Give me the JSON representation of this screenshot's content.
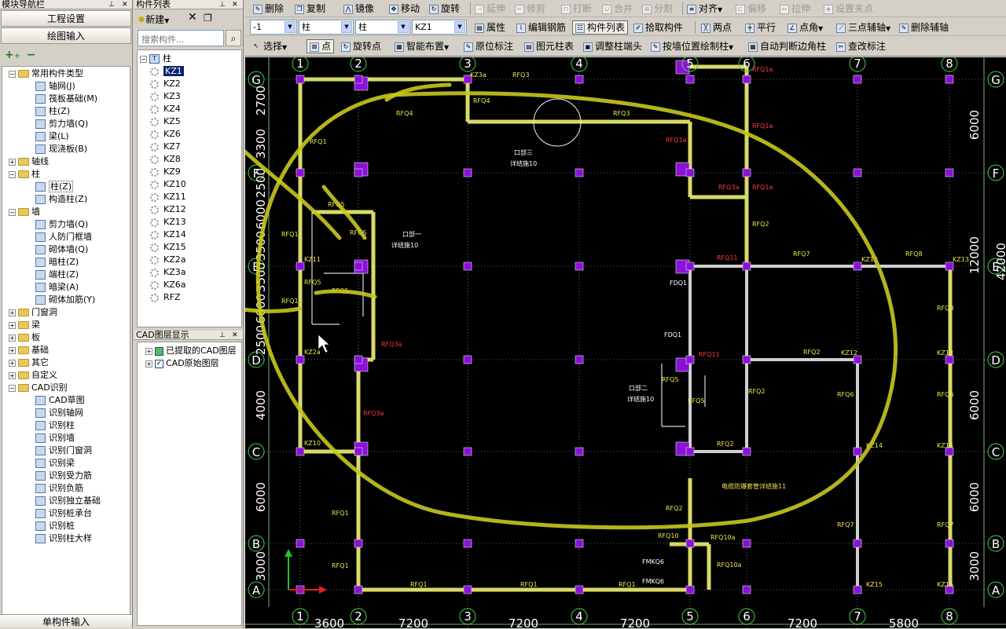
{
  "nav": {
    "title": "模块导航栏",
    "btn_project_settings": "工程设置",
    "btn_drawing_input": "绘图输入",
    "tree": [
      {
        "label": "常用构件类型",
        "folder": true,
        "exp": "−",
        "lvl": 0
      },
      {
        "label": "轴网(J)",
        "lvl": 1,
        "icon": "grid-icon"
      },
      {
        "label": "筏板基础(M)",
        "lvl": 1,
        "icon": "raft-foundation-icon"
      },
      {
        "label": "柱(Z)",
        "lvl": 1,
        "icon": "column-icon"
      },
      {
        "label": "剪力墙(Q)",
        "lvl": 1,
        "icon": "shear-wall-icon"
      },
      {
        "label": "梁(L)",
        "lvl": 1,
        "icon": "beam-icon"
      },
      {
        "label": "现浇板(B)",
        "lvl": 1,
        "icon": "slab-icon"
      },
      {
        "label": "轴线",
        "folder": true,
        "exp": "+",
        "lvl": 0
      },
      {
        "label": "柱",
        "folder": true,
        "exp": "−",
        "lvl": 0
      },
      {
        "label": "柱(Z)",
        "lvl": 1,
        "icon": "column-icon",
        "selected": true
      },
      {
        "label": "构造柱(Z)",
        "lvl": 1,
        "icon": "constructional-column-icon"
      },
      {
        "label": "墙",
        "folder": true,
        "exp": "−",
        "lvl": 0
      },
      {
        "label": "剪力墙(Q)",
        "lvl": 1,
        "icon": "shear-wall-icon"
      },
      {
        "label": "人防门框墙",
        "lvl": 1,
        "icon": "civil-defense-door-wall-icon"
      },
      {
        "label": "砌体墙(Q)",
        "lvl": 1,
        "icon": "masonry-wall-icon"
      },
      {
        "label": "暗柱(Z)",
        "lvl": 1,
        "icon": "hidden-column-icon"
      },
      {
        "label": "端柱(Z)",
        "lvl": 1,
        "icon": "end-column-icon"
      },
      {
        "label": "暗梁(A)",
        "lvl": 1,
        "icon": "hidden-beam-icon"
      },
      {
        "label": "砌体加筋(Y)",
        "lvl": 1,
        "icon": "masonry-rebar-icon"
      },
      {
        "label": "门窗洞",
        "folder": true,
        "exp": "+",
        "lvl": 0
      },
      {
        "label": "梁",
        "folder": true,
        "exp": "+",
        "lvl": 0
      },
      {
        "label": "板",
        "folder": true,
        "exp": "+",
        "lvl": 0
      },
      {
        "label": "基础",
        "folder": true,
        "exp": "+",
        "lvl": 0
      },
      {
        "label": "其它",
        "folder": true,
        "exp": "+",
        "lvl": 0
      },
      {
        "label": "自定义",
        "folder": true,
        "exp": "+",
        "lvl": 0
      },
      {
        "label": "CAD识别",
        "folder": true,
        "exp": "−",
        "lvl": 0
      },
      {
        "label": "CAD草图",
        "lvl": 1,
        "icon": "cad-sketch-icon"
      },
      {
        "label": "识别轴网",
        "lvl": 1,
        "icon": "recognize-grid-icon"
      },
      {
        "label": "识别柱",
        "lvl": 1,
        "icon": "recognize-column-icon"
      },
      {
        "label": "识别墙",
        "lvl": 1,
        "icon": "recognize-wall-icon"
      },
      {
        "label": "识别门窗洞",
        "lvl": 1,
        "icon": "recognize-opening-icon"
      },
      {
        "label": "识别梁",
        "lvl": 1,
        "icon": "recognize-beam-icon"
      },
      {
        "label": "识别受力筋",
        "lvl": 1,
        "icon": "recognize-main-rebar-icon"
      },
      {
        "label": "识别负筋",
        "lvl": 1,
        "icon": "recognize-negative-rebar-icon"
      },
      {
        "label": "识别独立基础",
        "lvl": 1,
        "icon": "recognize-footing-icon"
      },
      {
        "label": "识别桩承台",
        "lvl": 1,
        "icon": "recognize-pile-cap-icon"
      },
      {
        "label": "识别桩",
        "lvl": 1,
        "icon": "recognize-pile-icon"
      },
      {
        "label": "识别柱大样",
        "lvl": 1,
        "icon": "recognize-column-detail-icon"
      }
    ],
    "bottom_btn": "单构件输入"
  },
  "comp": {
    "title": "构件列表",
    "new_label": "新建",
    "search_placeholder": "搜索构件...",
    "root_label": "柱",
    "items": [
      "KZ1",
      "KZ2",
      "KZ3",
      "KZ4",
      "KZ5",
      "KZ6",
      "KZ7",
      "KZ8",
      "KZ9",
      "KZ10",
      "KZ11",
      "KZ12",
      "KZ13",
      "KZ14",
      "KZ15",
      "KZ2a",
      "KZ3a",
      "KZ6a",
      "RFZ"
    ]
  },
  "cadlayer": {
    "title": "CAD图层显示",
    "items": [
      "已提取的CAD图层",
      "CAD原始图层"
    ]
  },
  "toolbar1": {
    "delete": "删除",
    "copy": "复制",
    "mirror": "镜像",
    "move": "移动",
    "rotate": "旋转",
    "extend": "延伸",
    "trim": "修剪",
    "break": "打断",
    "merge": "合并",
    "split": "分割",
    "align": "对齐",
    "offset": "偏移",
    "stretch": "拉伸",
    "set_grip": "设置夹点"
  },
  "toolbar2": {
    "floor": "-1",
    "type": "柱",
    "subtype": "柱",
    "component": "KZ1",
    "property": "属性",
    "edit_rebar": "编辑钢筋",
    "component_list": "构件列表",
    "pick": "拾取构件",
    "two_points": "两点",
    "parallel": "平行",
    "point_angle": "点角",
    "three_point_aux": "三点辅轴",
    "delete_aux": "删除辅轴"
  },
  "toolbar3": {
    "select": "选择",
    "point": "点",
    "rotate_point": "旋转点",
    "smart_layout": "智能布置",
    "orig_label": "原位标注",
    "element_column_table": "图元柱表",
    "adjust_column_end": "调整柱端头",
    "draw_by_wall": "按墙位置绘制柱",
    "auto_corner_column": "自动判断边角柱",
    "check_label": "查改标注"
  },
  "drawing": {
    "row_axes": [
      "A",
      "B",
      "C",
      "D",
      "E",
      "F",
      "G"
    ],
    "col_axes": [
      "1",
      "2",
      "3",
      "4",
      "5",
      "6",
      "7",
      "8"
    ],
    "bottom_dims": [
      "3600",
      "7200",
      "7200",
      "7200",
      "7200",
      "5800"
    ],
    "left_dims": [
      "3000",
      "6000",
      "4000",
      "2500",
      "6000",
      "3500",
      "3500",
      "6000",
      "2500",
      "3300",
      "2700"
    ],
    "right_dims": [
      "3000",
      "6000",
      "6000",
      "12000",
      "6000"
    ],
    "right_dims_partial": [
      "42000"
    ],
    "labels": {
      "kz13": "KZ13",
      "kz12": "KZ12",
      "kz11": "KZ11",
      "kz10": "KZ10",
      "kz14a": "KZ14",
      "kz14b": "KZ14",
      "kz15a": "KZ15",
      "kz15b": "KZ15",
      "kz2a": "KZ2a",
      "kz3a": "KZ3a",
      "kz12b": "KZ12",
      "kz13b": "KZ13",
      "rfq1": "RFQ1",
      "rfq2": "RFQ2",
      "rfq3": "RFQ3",
      "rfq4": "RFQ4",
      "rfq5": "RFQ5",
      "rfq6": "RFQ6",
      "rfq7": "RFQ7",
      "rfq8": "RFQ8",
      "rfq10": "RFQ10",
      "rfq10a": "RFQ10a",
      "rfq1a": "RFQ1a",
      "rfq3a": "RFQ3a",
      "rfq11": "RFQ11",
      "fdq1": "FDQ1",
      "fmk": "FMKQ6",
      "kou3": "口部三",
      "kou2": "口部二",
      "kou1": "口部一",
      "detail10": "详结施10",
      "cable_note": "电缆防爆套管详结施11"
    }
  },
  "colors": {
    "canvas": "#000000",
    "grid": "#ffffff",
    "wall": "#d9d96a",
    "wall_white": "#cfcfcf",
    "column": "#8a12d6",
    "annotation_pen": "#c8c81e",
    "dim": "#ffffff",
    "axis_circle": "#45d64b",
    "label_yellow": "#f0e64a",
    "label_red": "#ff3a3a"
  }
}
